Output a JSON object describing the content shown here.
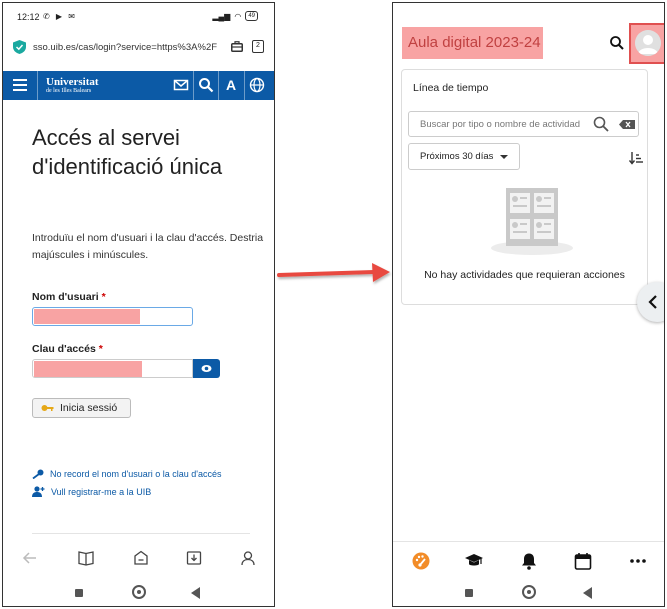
{
  "left_phone": {
    "status": {
      "time": "12:12",
      "battery": "49"
    },
    "browser": {
      "url": "sso.uib.es/cas/login?service=https%3A%2F",
      "tab_count": "2"
    },
    "site_header": {
      "logo_line1": "Universitat",
      "logo_line2": "de les Illes Balears"
    },
    "login": {
      "title": "Accés al servei d'identificació única",
      "intro": "Introduïu el nom d'usuari i la clau d'accés. Destria majúscules i minúscules.",
      "username_label": "Nom d'usuari",
      "password_label": "Clau d'accés",
      "required_mark": "*",
      "submit_label": "Inicia sessió",
      "forgot_link": "No record el nom d'usuari o la clau d'accés",
      "register_link": "Vull registrar-me a la UIB"
    }
  },
  "right_phone": {
    "header": {
      "title": "Aula digital 2023-24"
    },
    "timeline": {
      "title": "Línea de tiempo",
      "search_placeholder": "Buscar por tipo o nombre de actividad",
      "filter_value": "Próximos 30 días",
      "empty_message": "No hay actividades que requieran acciones"
    }
  },
  "colors": {
    "uib_blue": "#0c5aa6",
    "redaction": "#f8a3a3",
    "highlight_border": "#e05050",
    "arrow": "#e8493f",
    "dashboard_accent": "#f28c28"
  }
}
